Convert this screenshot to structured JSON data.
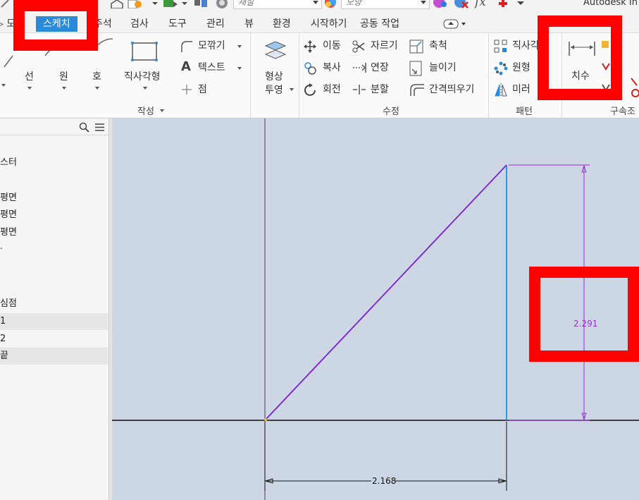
{
  "titlebar": {
    "style_combo": "재질",
    "appearance_combo": "모양",
    "fx_label": "fx",
    "app_title": "Autodesk In"
  },
  "tabs": [
    {
      "label": "모",
      "active": false
    },
    {
      "label": "스케치",
      "active": true
    },
    {
      "label": "주석",
      "active": false
    },
    {
      "label": "검사",
      "active": false
    },
    {
      "label": "도구",
      "active": false
    },
    {
      "label": "관리",
      "active": false
    },
    {
      "label": "뷰",
      "active": false
    },
    {
      "label": "환경",
      "active": false
    },
    {
      "label": "시작하기",
      "active": false
    },
    {
      "label": "공동 작업",
      "active": false
    }
  ],
  "ribbon": {
    "create": {
      "line": "선",
      "circle": "원",
      "arc": "호",
      "rectangle": "직사각형",
      "fillet": "모깎기",
      "text": "텍스트",
      "point": "점",
      "group_label": "작성"
    },
    "project": {
      "label_line1": "형상",
      "label_line2": "투영"
    },
    "modify": {
      "move": "이동",
      "trim": "자르기",
      "scale": "축척",
      "copy": "복사",
      "extend": "연장",
      "stretch": "늘이기",
      "rotate": "회전",
      "split": "분할",
      "offset": "간격띄우기",
      "group_label": "수정"
    },
    "pattern": {
      "rectangular": "직사각형",
      "circular": "원형",
      "mirror": "미러",
      "group_label": "패턴"
    },
    "constrain": {
      "dimension": "치수",
      "group_label": "구속조"
    }
  },
  "browser": {
    "items": [
      {
        "label": "스터",
        "selected": false
      },
      {
        "label": "평면",
        "selected": false
      },
      {
        "label": "평면",
        "selected": false
      },
      {
        "label": "평면",
        "selected": false
      },
      {
        "label": "심점",
        "selected": false
      },
      {
        "label": "1",
        "selected": true
      },
      {
        "label": "2",
        "selected": false
      },
      {
        "label": "끝",
        "selected": true
      }
    ]
  },
  "sketch": {
    "horizontal_dimension": "2.168",
    "vertical_dimension": "2.291",
    "colors": {
      "canvas_bg": "#cdd6e4",
      "hypotenuse": "#7a1fd6",
      "vertical_edge": "#1e90e0",
      "dimension": "#9a2fd6",
      "axis": "#111111",
      "annotation": "#ff0000"
    }
  }
}
